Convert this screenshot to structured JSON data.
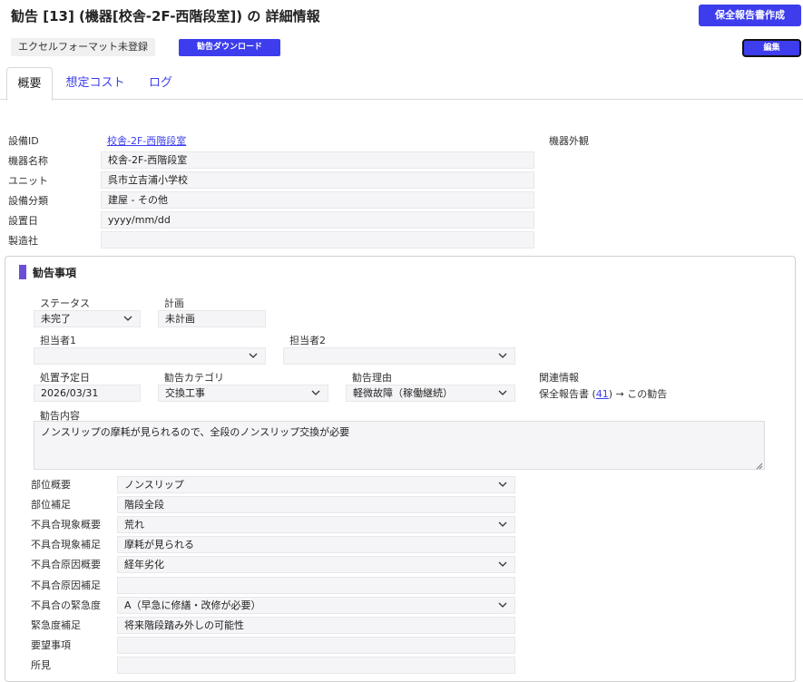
{
  "header": {
    "title": "勧告 [13] (機器[校舎-2F-西階段室]) の 詳細情報",
    "create_report_label": "保全報告書作成",
    "excel_status": "エクセルフォーマット未登録",
    "download_label": "勧告ダウンロード",
    "edit_label": "編集"
  },
  "tabs": [
    {
      "label": "概要"
    },
    {
      "label": "想定コスト"
    },
    {
      "label": "ログ"
    }
  ],
  "equipment": {
    "id_label": "設備ID",
    "id_value": "校舎-2F-西階段室",
    "name_label": "機器名称",
    "name_value": "校舎-2F-西階段室",
    "unit_label": "ユニット",
    "unit_value": "呉市立吉浦小学校",
    "category_label": "設備分類",
    "category_value": "建屋 - その他",
    "install_label": "設置日",
    "install_value": "yyyy/mm/dd",
    "maker_label": "製造社",
    "maker_value": "",
    "appearance_label": "機器外観"
  },
  "recommendation": {
    "section_title": "勧告事項",
    "status_label": "ステータス",
    "status_value": "未完了",
    "plan_label": "計画",
    "plan_value": "未計画",
    "assignee1_label": "担当者1",
    "assignee1_value": "",
    "assignee2_label": "担当者2",
    "assignee2_value": "",
    "due_label": "処置予定日",
    "due_value": "2026/03/31",
    "rec_category_label": "勧告カテゴリ",
    "rec_category_value": "交換工事",
    "reason_label": "勧告理由",
    "reason_value": "軽微故障（稼働継続）",
    "related_label": "関連情報",
    "related_prefix": "保全報告書 (",
    "related_link": "41",
    "related_suffix": ") → この勧告",
    "content_label": "勧告内容",
    "content_value": "ノンスリップの摩耗が見られるので、全段のノンスリップ交換が必要"
  },
  "details": [
    {
      "label": "部位概要",
      "value": "ノンスリップ",
      "select": true
    },
    {
      "label": "部位補足",
      "value": "階段全段",
      "select": false
    },
    {
      "label": "不具合現象概要",
      "value": "荒れ",
      "select": true
    },
    {
      "label": "不具合現象補足",
      "value": "摩耗が見られる",
      "select": false
    },
    {
      "label": "不具合原因概要",
      "value": "経年劣化",
      "select": true
    },
    {
      "label": "不具合原因補足",
      "value": "",
      "select": false
    },
    {
      "label": "不具合の緊急度",
      "value": "A（早急に修繕・改修が必要）",
      "select": true
    },
    {
      "label": "緊急度補足",
      "value": "将来階段踏み外しの可能性",
      "select": false
    },
    {
      "label": "要望事項",
      "value": "",
      "select": false
    },
    {
      "label": "所見",
      "value": "",
      "select": false
    }
  ],
  "colors": {
    "accent": "#3d3ded",
    "section_marker": "#6b4fd8"
  },
  "icons": {
    "select": "chevron-down-icon",
    "resize": "resize-handle-icon"
  }
}
